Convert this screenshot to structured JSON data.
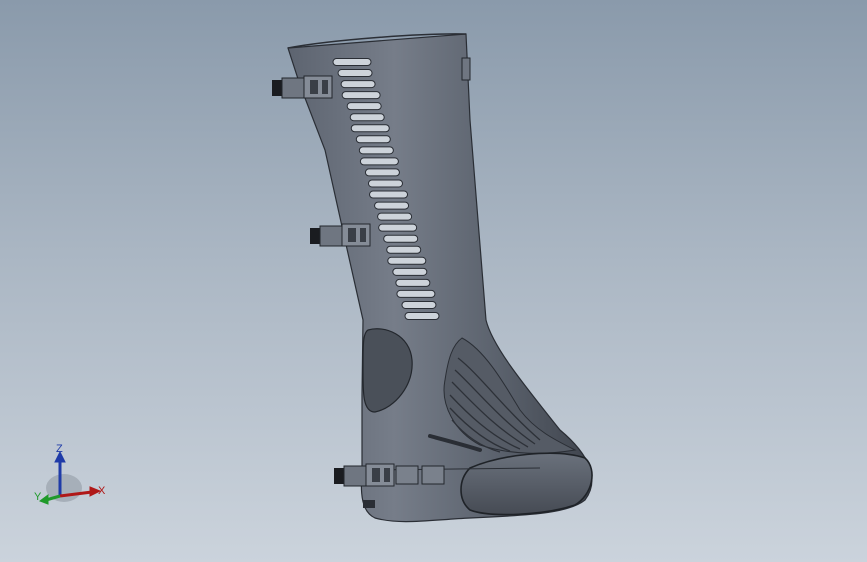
{
  "viewport": {
    "model": "brace-part"
  },
  "triad": {
    "z_label": "Z",
    "x_label": "X",
    "y_label": "Y",
    "colors": {
      "z": "#1f3ba8",
      "x": "#b01818",
      "y": "#1f9a2a"
    }
  },
  "icons": [
    "strap-clip-icon",
    "triad-icon"
  ]
}
